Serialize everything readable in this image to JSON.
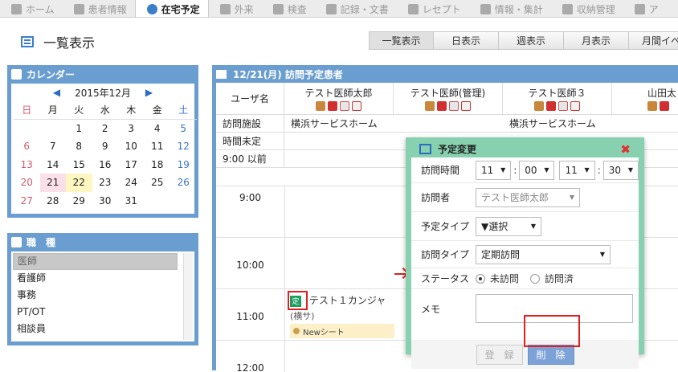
{
  "nav": {
    "tabs": [
      "ホーム",
      "患者情報",
      "在宅予定",
      "外来",
      "検査",
      "記録・文書",
      "レセプト",
      "情報・集計",
      "収納管理",
      "ア"
    ],
    "active": 2
  },
  "page": {
    "title": "一覧表示"
  },
  "view_tabs": [
    "一覧表示",
    "日表示",
    "週表示",
    "月表示",
    "月間イベ"
  ],
  "calendar": {
    "header": "カレンダー",
    "month": "2015年12月",
    "prev": "◀",
    "next": "▶",
    "dow": [
      "日",
      "月",
      "火",
      "水",
      "木",
      "金",
      "土"
    ],
    "weeks": [
      [
        "",
        "",
        "1",
        "2",
        "3",
        "4",
        "5"
      ],
      [
        "6",
        "7",
        "8",
        "9",
        "10",
        "11",
        "12"
      ],
      [
        "13",
        "14",
        "15",
        "16",
        "17",
        "18",
        "19"
      ],
      [
        "20",
        "21",
        "22",
        "23",
        "24",
        "25",
        "26"
      ],
      [
        "27",
        "28",
        "29",
        "30",
        "31",
        "",
        ""
      ]
    ],
    "highlight_pink": "21",
    "highlight_yellow": "22"
  },
  "job_types": {
    "header": "職　種",
    "items": [
      "医師",
      "看護師",
      "事務",
      "PT/OT",
      "相談員"
    ]
  },
  "schedule": {
    "header": "12/21(月) 訪問予定患者",
    "user_label": "ユーザ名",
    "doctors": [
      "テスト医師太郎",
      "テスト医師(管理)",
      "テスト医師３",
      "山田太"
    ],
    "rows": [
      {
        "label": "訪問施設",
        "cells": [
          "横浜サービスホーム",
          "",
          "横浜サービスホーム",
          ""
        ]
      },
      {
        "label": "時間未定",
        "cells": [
          "",
          "",
          "",
          ""
        ]
      },
      {
        "label": "9:00 以前",
        "cells": [
          "",
          "",
          "",
          ""
        ]
      }
    ],
    "hours": [
      "9:00",
      "10:00",
      "11:00",
      "12:00"
    ],
    "event": {
      "tag": "定",
      "name": "テスト１カンジャ",
      "sub": "(横サ)",
      "sheet": "Newシート"
    }
  },
  "dialog": {
    "title": "予定変更",
    "close": "✖",
    "visit_time_label": "訪問時間",
    "time": {
      "h1": "11",
      "m1": "00",
      "h2": "11",
      "m2": "30",
      "sep": ":"
    },
    "visitor_label": "訪問者",
    "visitor": "テスト医師太郎",
    "plan_type_label": "予定タイプ",
    "plan_type": "▼選択",
    "visit_type_label": "訪問タイプ",
    "visit_type": "定期訪問",
    "status_label": "ステータス",
    "status_options": [
      "未訪問",
      "訪問済"
    ],
    "memo_label": "メモ",
    "register_btn": "登　録",
    "delete_btn": "削　除"
  }
}
